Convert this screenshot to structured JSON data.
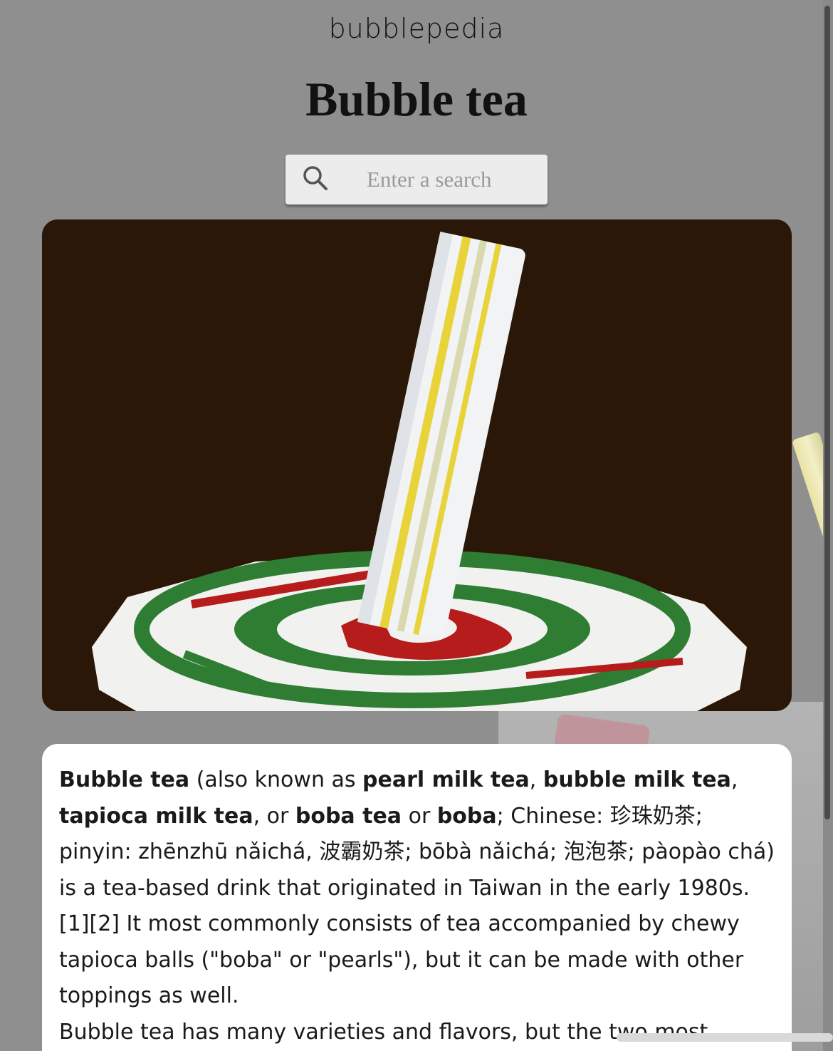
{
  "brand": "bubblepedia",
  "page_title": "Bubble tea",
  "search": {
    "placeholder": "Enter a search",
    "value": ""
  },
  "hero_image": {
    "alt": "Bubble tea cup with straw"
  },
  "article": {
    "p1": {
      "b1": "Bubble tea",
      "t1": " (also known as ",
      "b2": "pearl milk tea",
      "t2": ", ",
      "b3": "bubble milk tea",
      "t3": ", ",
      "b4": "tapioca milk tea",
      "t4": ", or ",
      "b5": "boba tea",
      "t5": " or ",
      "b6": "boba",
      "t6": "; Chinese: 珍珠奶茶; pinyin: zhēnzhū nǎichá, 波霸奶茶; bōbà nǎichá; 泡泡茶; pàopào chá) is a tea-based drink that originated in Taiwan in the early 1980s.[1][2] It most commonly consists of tea accompanied by chewy tapioca balls (\"boba\" or \"pearls\"), but it can be made with other toppings as well."
    },
    "p2": "Bubble tea has many varieties and flavors, but the two most"
  },
  "colors": {
    "page_bg": "#8f8f8f",
    "hero_bg": "#2a1707",
    "lid_green": "#2e7d32",
    "lid_red": "#b71c1c",
    "straw_yellow": "#e8d33a"
  }
}
